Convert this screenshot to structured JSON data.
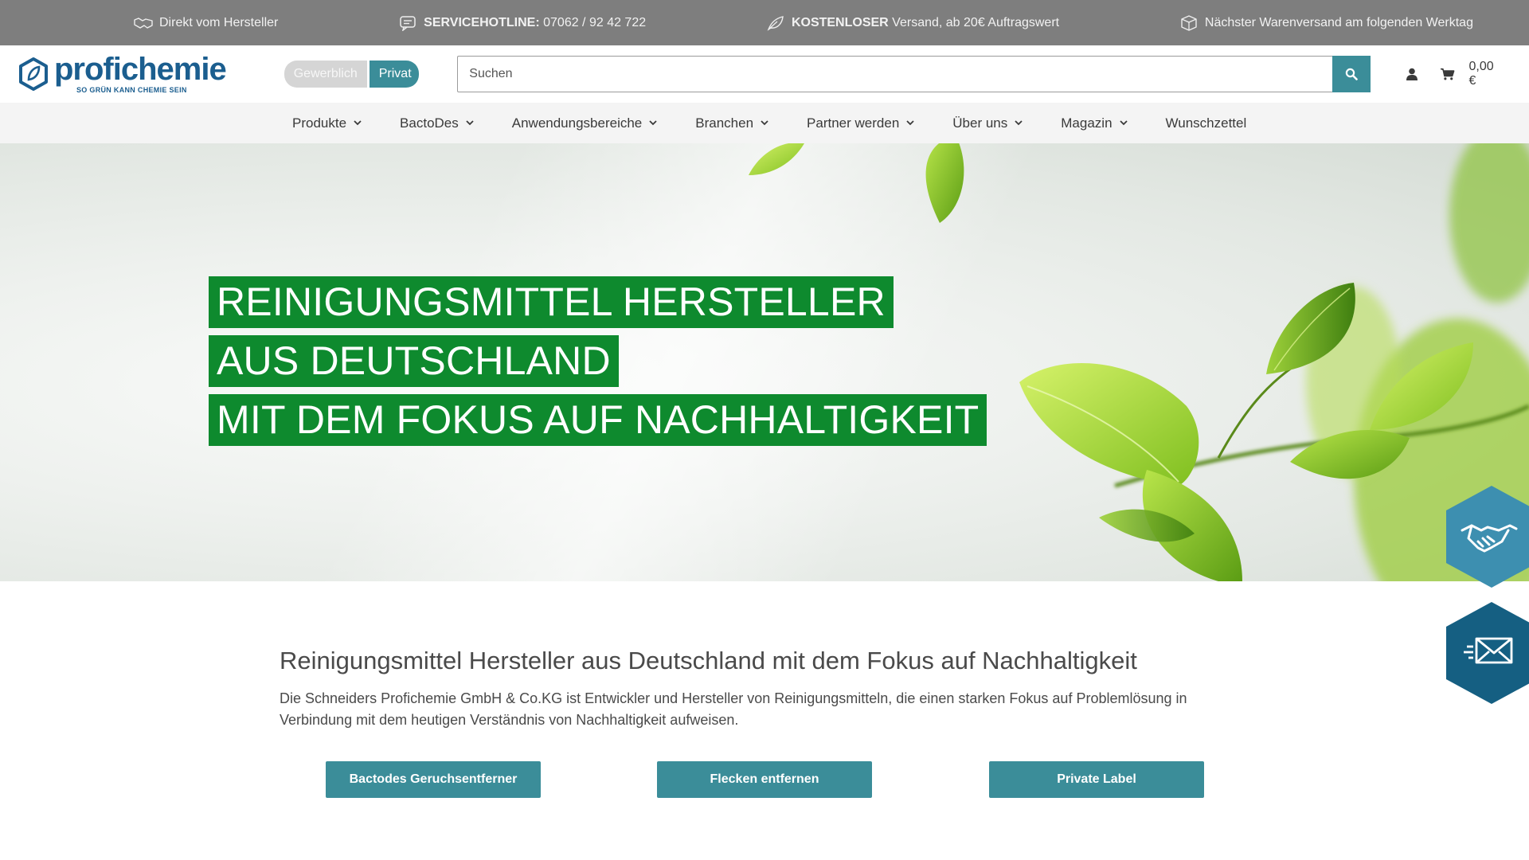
{
  "topbar": {
    "usp1": "Direkt vom Hersteller",
    "usp2_bold": "SERVICEHOTLINE:",
    "usp2_text": " 07062 / 92 42 722",
    "usp3_bold": "KOSTENLOSER",
    "usp3_text": " Versand, ab 20€ Auftragswert",
    "usp4": "Nächster Warenversand am folgenden Werktag"
  },
  "header": {
    "brand": "profichemie",
    "slogan": "SO GRÜN KANN CHEMIE SEIN",
    "customer_type_business": "Gewerblich",
    "customer_type_private": "Privat",
    "search_placeholder": "Suchen",
    "cart_total": "0,00 €"
  },
  "nav": {
    "items": [
      "Produkte",
      "BactoDes",
      "Anwendungsbereiche",
      "Branchen",
      "Partner werden",
      "Über uns",
      "Magazin",
      "Wunschzettel"
    ]
  },
  "hero": {
    "line1": "REINIGUNGSMITTEL HERSTELLER",
    "line2": "AUS DEUTSCHLAND",
    "line3": "MIT DEM FOKUS AUF NACHHALTIGKEIT"
  },
  "intro": {
    "title": "Reinigungsmittel Hersteller aus Deutschland mit dem Fokus auf Nachhaltigkeit",
    "text": "Die Schneiders Profichemie GmbH & Co.KG ist Entwickler und Hersteller von Reinigungsmitteln, die einen starken Fokus auf Problemlösung in Verbindung mit dem heutigen Verständnis von Nachhaltigkeit aufweisen."
  },
  "cta": {
    "button1": "Bactodes Geruchsentferner",
    "button2": "Flecken entfernen",
    "button3": "Private Label"
  },
  "colors": {
    "topbar": "#7e7e7e",
    "accent_teal": "#3b8d99",
    "hero_green": "#0e8a2e",
    "brand_blue": "#1b5e8f",
    "float_light": "#3d8fb0",
    "float_dark": "#155f82"
  },
  "icons": {
    "usp1": "handshake-icon",
    "usp2": "chat-icon",
    "usp3": "leaf-icon",
    "usp4": "package-icon",
    "search": "search-icon",
    "account": "user-icon",
    "cart": "cart-icon",
    "float1": "handshake-icon",
    "float2": "mail-icon"
  }
}
